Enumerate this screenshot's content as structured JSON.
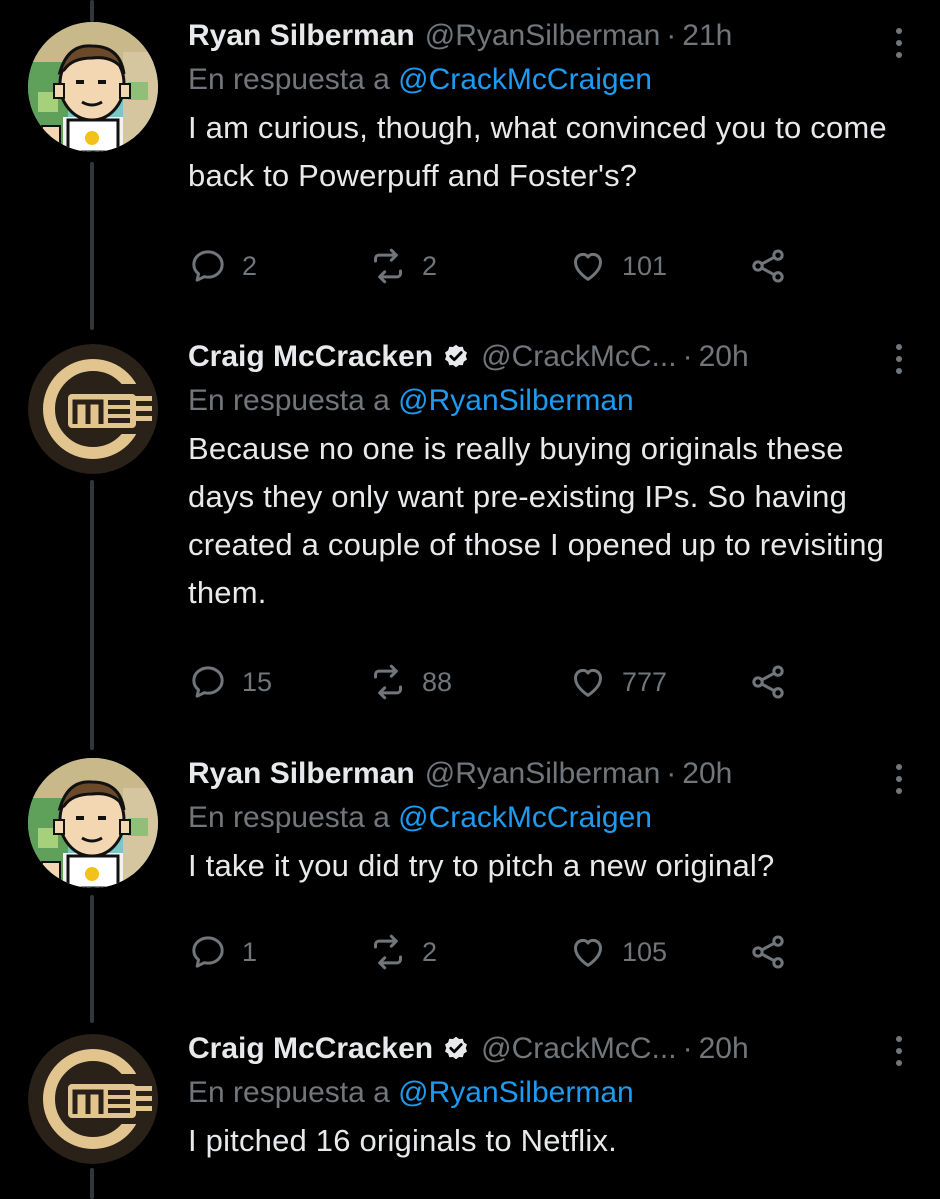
{
  "tweets": [
    {
      "name": "Ryan Silberman",
      "handle": "@RyanSilberman",
      "time": "21h",
      "verified": false,
      "reply_prefix": "En respuesta a",
      "reply_mention": "@CrackMcCraigen",
      "text": "I am curious, though, what convinced you to come back to Powerpuff and Foster's?",
      "replies": "2",
      "retweets": "2",
      "likes": "101"
    },
    {
      "name": "Craig McCracken",
      "handle": "@CrackMcC...",
      "time": "20h",
      "verified": true,
      "reply_prefix": "En respuesta a",
      "reply_mention": "@RyanSilberman",
      "text": "Because no one is really buying originals these days they only want pre-existing IPs. So having created a couple of those I opened up to revisiting them.",
      "replies": "15",
      "retweets": "88",
      "likes": "777"
    },
    {
      "name": "Ryan Silberman",
      "handle": "@RyanSilberman",
      "time": "20h",
      "verified": false,
      "reply_prefix": "En respuesta a",
      "reply_mention": "@CrackMcCraigen",
      "text": "I take it you did try to pitch a new original?",
      "replies": "1",
      "retweets": "2",
      "likes": "105"
    },
    {
      "name": "Craig McCracken",
      "handle": "@CrackMcC...",
      "time": "20h",
      "verified": true,
      "reply_prefix": "En respuesta a",
      "reply_mention": "@RyanSilberman",
      "text": "I pitched 16 originals to Netflix."
    }
  ],
  "colors": {
    "background": "#000000",
    "text": "#e7e9ea",
    "secondary": "#71767b",
    "accent": "#1d9bf0",
    "thread_line": "#333639"
  },
  "icons": [
    "reply-icon",
    "retweet-icon",
    "like-icon",
    "share-icon",
    "more-icon",
    "verified-icon"
  ]
}
